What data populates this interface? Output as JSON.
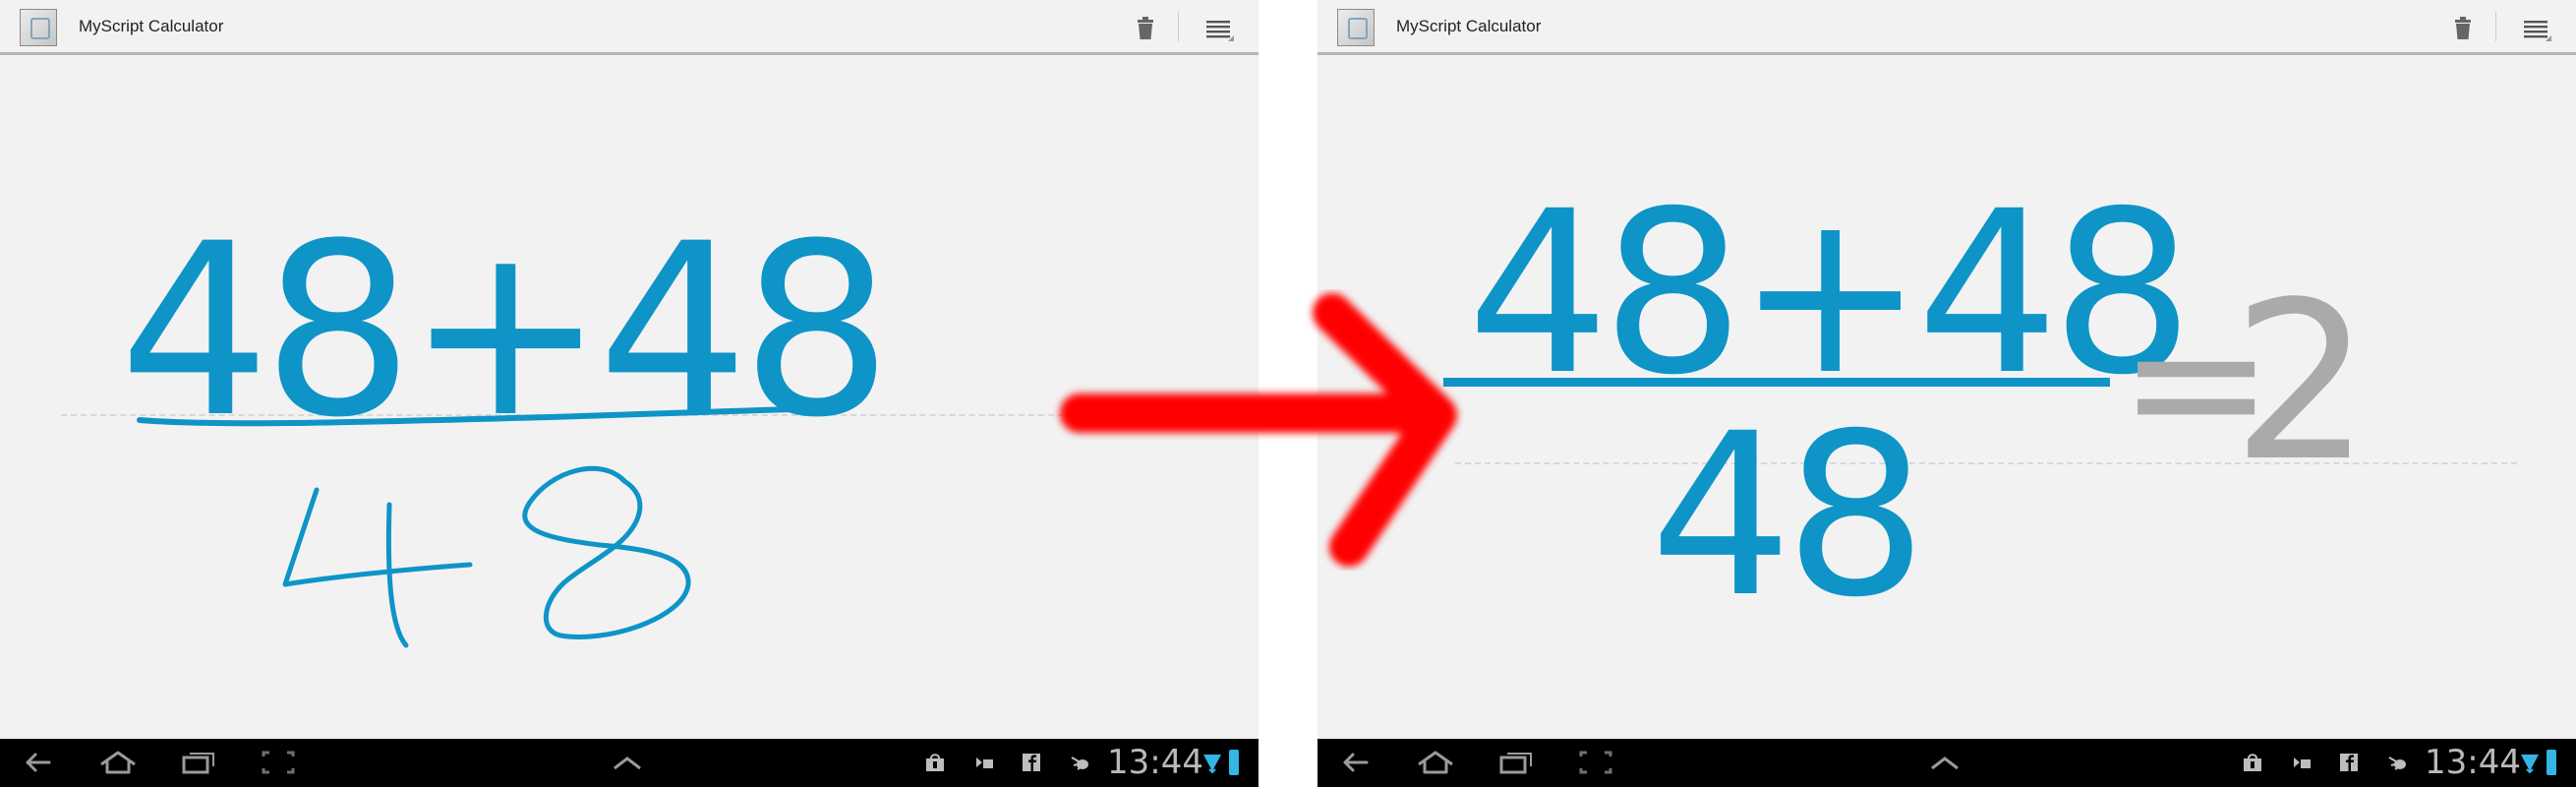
{
  "app": {
    "title": "MyScript Calculator"
  },
  "left": {
    "expression_top": "48+48"
  },
  "right": {
    "numerator": "48+48",
    "denominator": "48",
    "equals": "=",
    "result": "2"
  },
  "status": {
    "time": "13:44"
  },
  "icons": {
    "app": "myscript-app-icon",
    "clear": "trash-icon",
    "menu": "menu-icon",
    "back": "back-icon",
    "home": "home-icon",
    "recents": "recent-apps-icon",
    "screenshot": "screenshot-icon",
    "up": "chevron-up-icon",
    "notifications": [
      "shopping-bag-icon",
      "download-icon",
      "facebook-icon",
      "bug-icon"
    ],
    "wifi": "wifi-icon",
    "battery": "battery-icon"
  },
  "colors": {
    "ink": "#0e94c7",
    "result": "#aaaaaa",
    "arrow": "#ff0000",
    "background": "#f2f2f2",
    "navbar": "#000000"
  }
}
